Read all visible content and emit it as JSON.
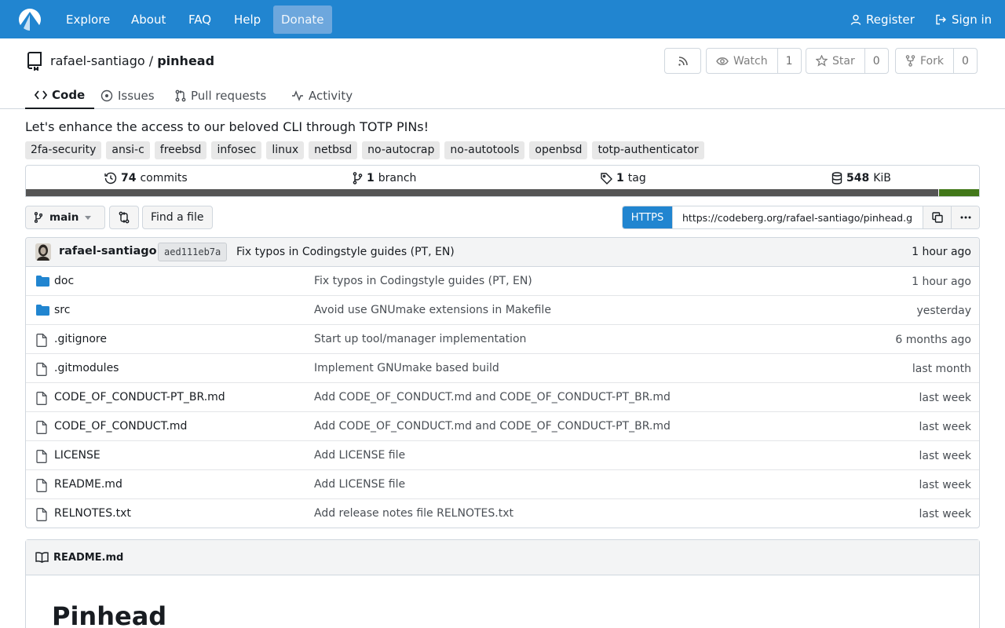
{
  "nav": {
    "links": [
      "Explore",
      "About",
      "FAQ",
      "Help"
    ],
    "donate": "Donate",
    "register": "Register",
    "sign_in": "Sign in"
  },
  "repo": {
    "owner": "rafael-santiago",
    "separator": "/",
    "name": "pinhead",
    "watch_label": "Watch",
    "watch_count": "1",
    "star_label": "Star",
    "star_count": "0",
    "fork_label": "Fork",
    "fork_count": "0"
  },
  "tabs": [
    "Code",
    "Issues",
    "Pull requests",
    "Activity"
  ],
  "description": "Let's enhance the access to our beloved CLI through TOTP PINs!",
  "topics": [
    "2fa-security",
    "ansi-c",
    "freebsd",
    "infosec",
    "linux",
    "netbsd",
    "no-autocrap",
    "no-autotools",
    "openbsd",
    "totp-authenticator"
  ],
  "stats": {
    "commits_count": "74",
    "commits_label": "commits",
    "branches_count": "1",
    "branches_label": "branch",
    "tags_count": "1",
    "tags_label": "tag",
    "size_value": "548",
    "size_unit": "KiB"
  },
  "languages": [
    {
      "color": "#555555",
      "fraction": 0.957
    },
    {
      "color": "#427819",
      "fraction": 0.043
    }
  ],
  "branch": {
    "current": "main",
    "find_file": "Find a file",
    "protocol": "HTTPS",
    "clone_url": "https://codeberg.org/rafael-santiago/pinhead.git"
  },
  "latest_commit": {
    "author": "rafael-santiago",
    "sha": "aed111eb7a",
    "message": "Fix typos in Codingstyle guides (PT, EN)",
    "time": "1 hour ago"
  },
  "files": [
    {
      "name": "doc",
      "type": "dir",
      "message": "Fix typos in Codingstyle guides (PT, EN)",
      "time": "1 hour ago"
    },
    {
      "name": "src",
      "type": "dir",
      "message": "Avoid use GNUmake extensions in Makefile",
      "time": "yesterday"
    },
    {
      "name": ".gitignore",
      "type": "file",
      "message": "Start up tool/manager implementation",
      "time": "6 months ago"
    },
    {
      "name": ".gitmodules",
      "type": "file",
      "message": "Implement GNUmake based build",
      "time": "last month"
    },
    {
      "name": "CODE_OF_CONDUCT-PT_BR.md",
      "type": "file",
      "message": "Add CODE_OF_CONDUCT.md and CODE_OF_CONDUCT-PT_BR.md",
      "time": "last week"
    },
    {
      "name": "CODE_OF_CONDUCT.md",
      "type": "file",
      "message": "Add CODE_OF_CONDUCT.md and CODE_OF_CONDUCT-PT_BR.md",
      "time": "last week"
    },
    {
      "name": "LICENSE",
      "type": "file",
      "message": "Add LICENSE file",
      "time": "last week"
    },
    {
      "name": "README.md",
      "type": "file",
      "message": "Add LICENSE file",
      "time": "last week"
    },
    {
      "name": "RELNOTES.txt",
      "type": "file",
      "message": "Add release notes file RELNOTES.txt",
      "time": "last week"
    }
  ],
  "readme": {
    "filename": "README.md",
    "heading": "Pinhead"
  },
  "colors": {
    "nav_bg": "#2185d0",
    "folder": "#2185d0"
  },
  "icons": [
    "logo-icon",
    "register-icon",
    "sign-in-icon",
    "repo-icon",
    "rss-icon",
    "eye-icon",
    "star-icon",
    "fork-icon",
    "code-icon",
    "issues-icon",
    "pull-request-icon",
    "activity-icon",
    "history-icon",
    "branch-icon",
    "tag-icon",
    "database-icon",
    "compare-icon",
    "copy-icon",
    "kebab-icon",
    "folder-icon",
    "file-icon",
    "book-icon"
  ]
}
